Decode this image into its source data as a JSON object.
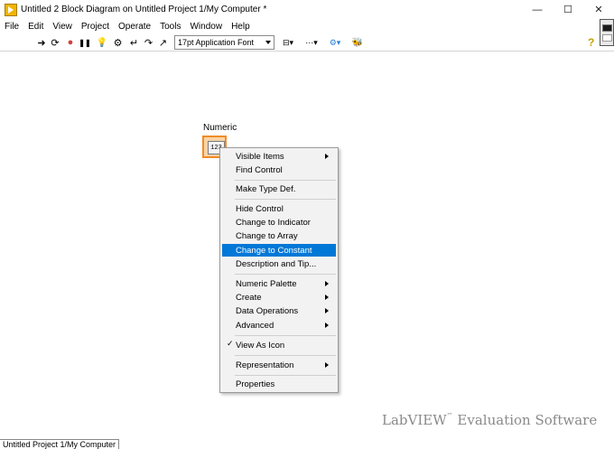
{
  "window": {
    "title": "Untitled 2 Block Diagram on Untitled Project 1/My Computer *",
    "controls": {
      "minimize": "—",
      "maximize": "☐",
      "close": "✕"
    }
  },
  "menubar": {
    "items": [
      "File",
      "Edit",
      "View",
      "Project",
      "Operate",
      "Tools",
      "Window",
      "Help"
    ]
  },
  "toolbar": {
    "icons": {
      "run": "➜",
      "run_continuously": "⟳",
      "abort": "●",
      "pause": "❚❚",
      "highlight": "💡",
      "retain_wire": "⚙",
      "step_into": "↵",
      "step_over": "↷",
      "step_out": "↗",
      "align": "⊟▾",
      "distribute": "⋯▾",
      "reorder": "⚙▾",
      "cleanup": "🐝"
    },
    "font_select": "17pt Application Font",
    "context_help": "?"
  },
  "diagram": {
    "node_label": "Numeric",
    "node_text": "123"
  },
  "context_menu": {
    "items": [
      {
        "label": "Visible Items",
        "submenu": true
      },
      {
        "label": "Find Control"
      },
      {
        "label": "Make Type Def."
      },
      {
        "label": "Hide Control"
      },
      {
        "label": "Change to Indicator"
      },
      {
        "label": "Change to Array"
      },
      {
        "label": "Change to Constant",
        "selected": true
      },
      {
        "label": "Description and Tip..."
      },
      {
        "label": "Numeric Palette",
        "submenu": true
      },
      {
        "label": "Create",
        "submenu": true
      },
      {
        "label": "Data Operations",
        "submenu": true
      },
      {
        "label": "Advanced",
        "submenu": true
      },
      {
        "label": "View As Icon",
        "checked": true,
        "check_mark": "✓"
      },
      {
        "label": "Representation",
        "submenu": true
      },
      {
        "label": "Properties"
      }
    ],
    "selected_color": "#0078d7"
  },
  "watermark": {
    "brand": "LabVIEW",
    "trademark": "™",
    "suffix": "Evaluation Software"
  },
  "statusbar": {
    "text": "Untitled Project 1/My Computer"
  },
  "colors": {
    "node_border": "#f08c28",
    "node_fill": "#fbd3a6",
    "app_icon": "#f2b400"
  }
}
